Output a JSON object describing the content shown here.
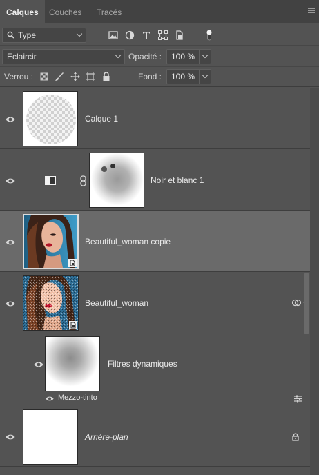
{
  "tabs": [
    {
      "label": "Calques",
      "active": true
    },
    {
      "label": "Couches",
      "active": false
    },
    {
      "label": "Tracés",
      "active": false
    }
  ],
  "filter": {
    "kind_label": "Type",
    "icons": [
      "image-filter-icon",
      "adjustment-filter-icon",
      "text-filter-icon",
      "shape-filter-icon",
      "smart-object-filter-icon"
    ]
  },
  "blend": {
    "mode": "Eclaircir",
    "opacity_label": "Opacité :",
    "opacity_value": "100 %"
  },
  "lock": {
    "label": "Verrou :",
    "fill_label": "Fond :",
    "fill_value": "100 %"
  },
  "layers": [
    {
      "name": "Calque 1",
      "visible": true,
      "selected": false
    },
    {
      "name": "Noir et blanc 1",
      "visible": true,
      "selected": false
    },
    {
      "name": "Beautiful_woman  copie",
      "visible": true,
      "selected": true
    },
    {
      "name": "Beautiful_woman",
      "visible": true,
      "selected": false
    },
    {
      "name": "Filtres dynamiques",
      "visible": true,
      "selected": false
    },
    {
      "name": "Mezzo-tinto",
      "visible": true,
      "selected": false
    },
    {
      "name": "Arrière-plan",
      "visible": true,
      "selected": false,
      "locked": true
    }
  ],
  "colors": {
    "panel_bg": "#535353",
    "selected_bg": "#6a6a6a",
    "tab_bar_bg": "#424242"
  }
}
